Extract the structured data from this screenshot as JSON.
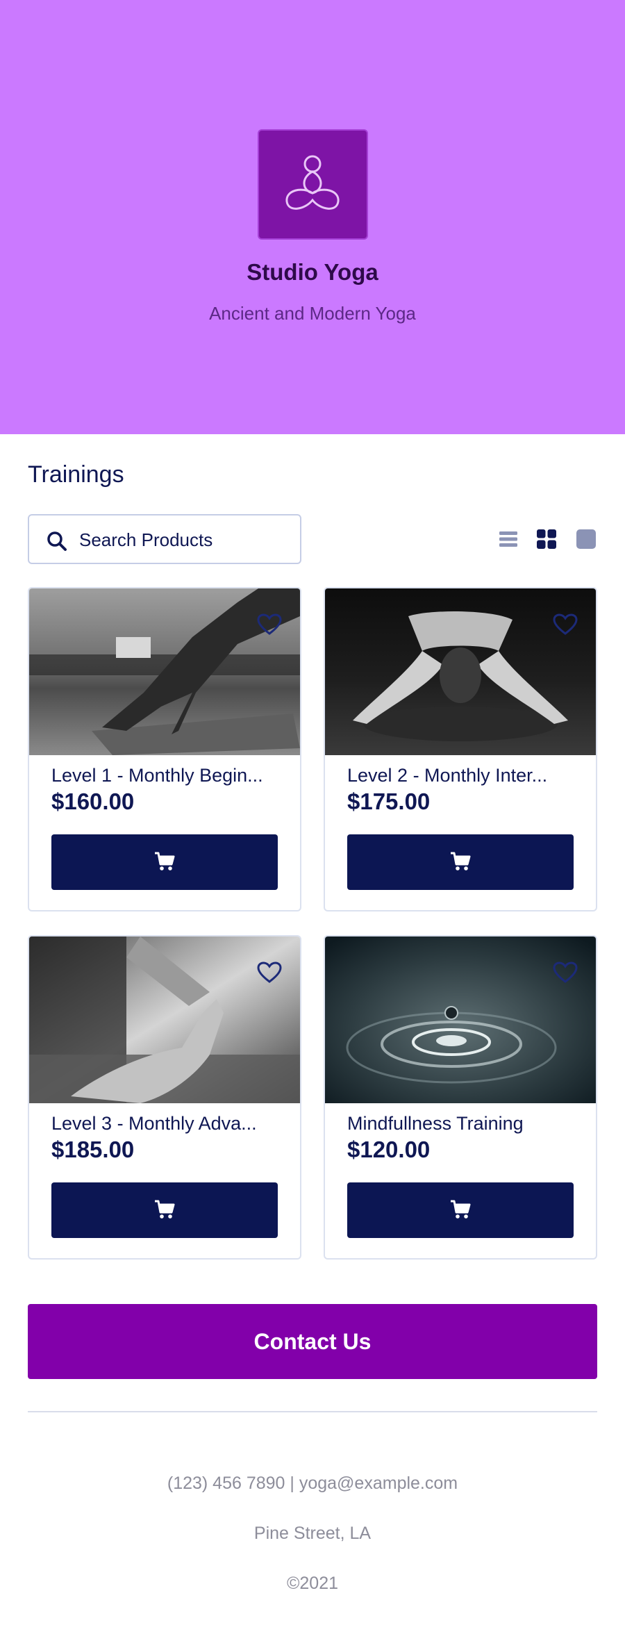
{
  "header": {
    "brand_name": "Studio Yoga",
    "tagline": "Ancient and Modern Yoga",
    "background_color": "#cb79ff",
    "logo_color": "#7e14a6",
    "logo_icon": "yoga-meditation-icon"
  },
  "catalog": {
    "section_title": "Trainings",
    "search": {
      "placeholder": "Search Products",
      "value": ""
    },
    "view_modes": [
      "list-view-icon",
      "grid-view-icon",
      "single-view-icon"
    ],
    "active_view": "grid-view-icon",
    "products": [
      {
        "name": "Level 1 - Monthly Begin...",
        "price": "$160.00",
        "image": "downward-dog-photo"
      },
      {
        "name": "Level 2 - Monthly Inter...",
        "price": "$175.00",
        "image": "child-pose-photo"
      },
      {
        "name": "Level 3 - Monthly Adva...",
        "price": "$185.00",
        "image": "mudra-hand-photo"
      },
      {
        "name": "Mindfullness Training",
        "price": "$120.00",
        "image": "water-drop-photo"
      }
    ],
    "cart_button_icon": "cart-icon",
    "favorite_icon": "heart-icon"
  },
  "contact": {
    "label": "Contact Us",
    "color": "#8200aa"
  },
  "footer": {
    "contact_line": "(123) 456 7890 | yoga@example.com",
    "address": "Pine Street, LA",
    "copyright": "©2021"
  },
  "colors": {
    "primary_dark": "#0c1653",
    "text": "#0f1753",
    "muted": "#8d8d9a"
  }
}
